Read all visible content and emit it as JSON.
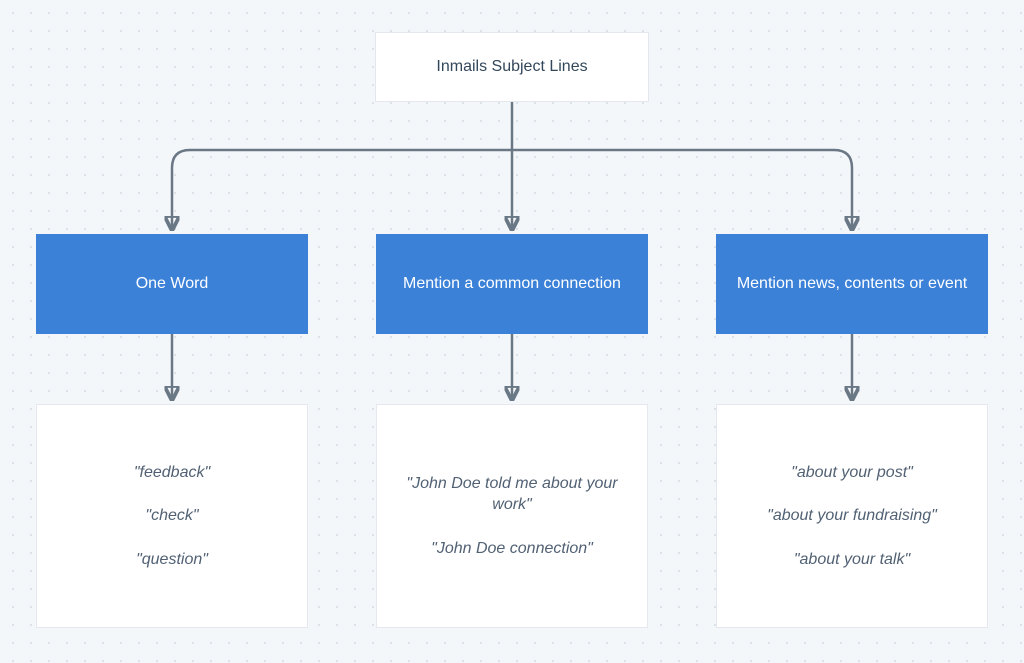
{
  "root": {
    "title": "Inmails Subject Lines"
  },
  "categories": [
    {
      "title": "One Word",
      "examples": [
        "\"feedback\"",
        "\"check\"",
        "\"question\""
      ]
    },
    {
      "title": "Mention a common connection",
      "examples": [
        "\"John Doe told me about your work\"",
        "\"John Doe connection\""
      ]
    },
    {
      "title": "Mention news, contents or event",
      "examples": [
        "\"about your post\"",
        "\"about your fundraising\"",
        "\"about your talk\""
      ]
    }
  ]
}
